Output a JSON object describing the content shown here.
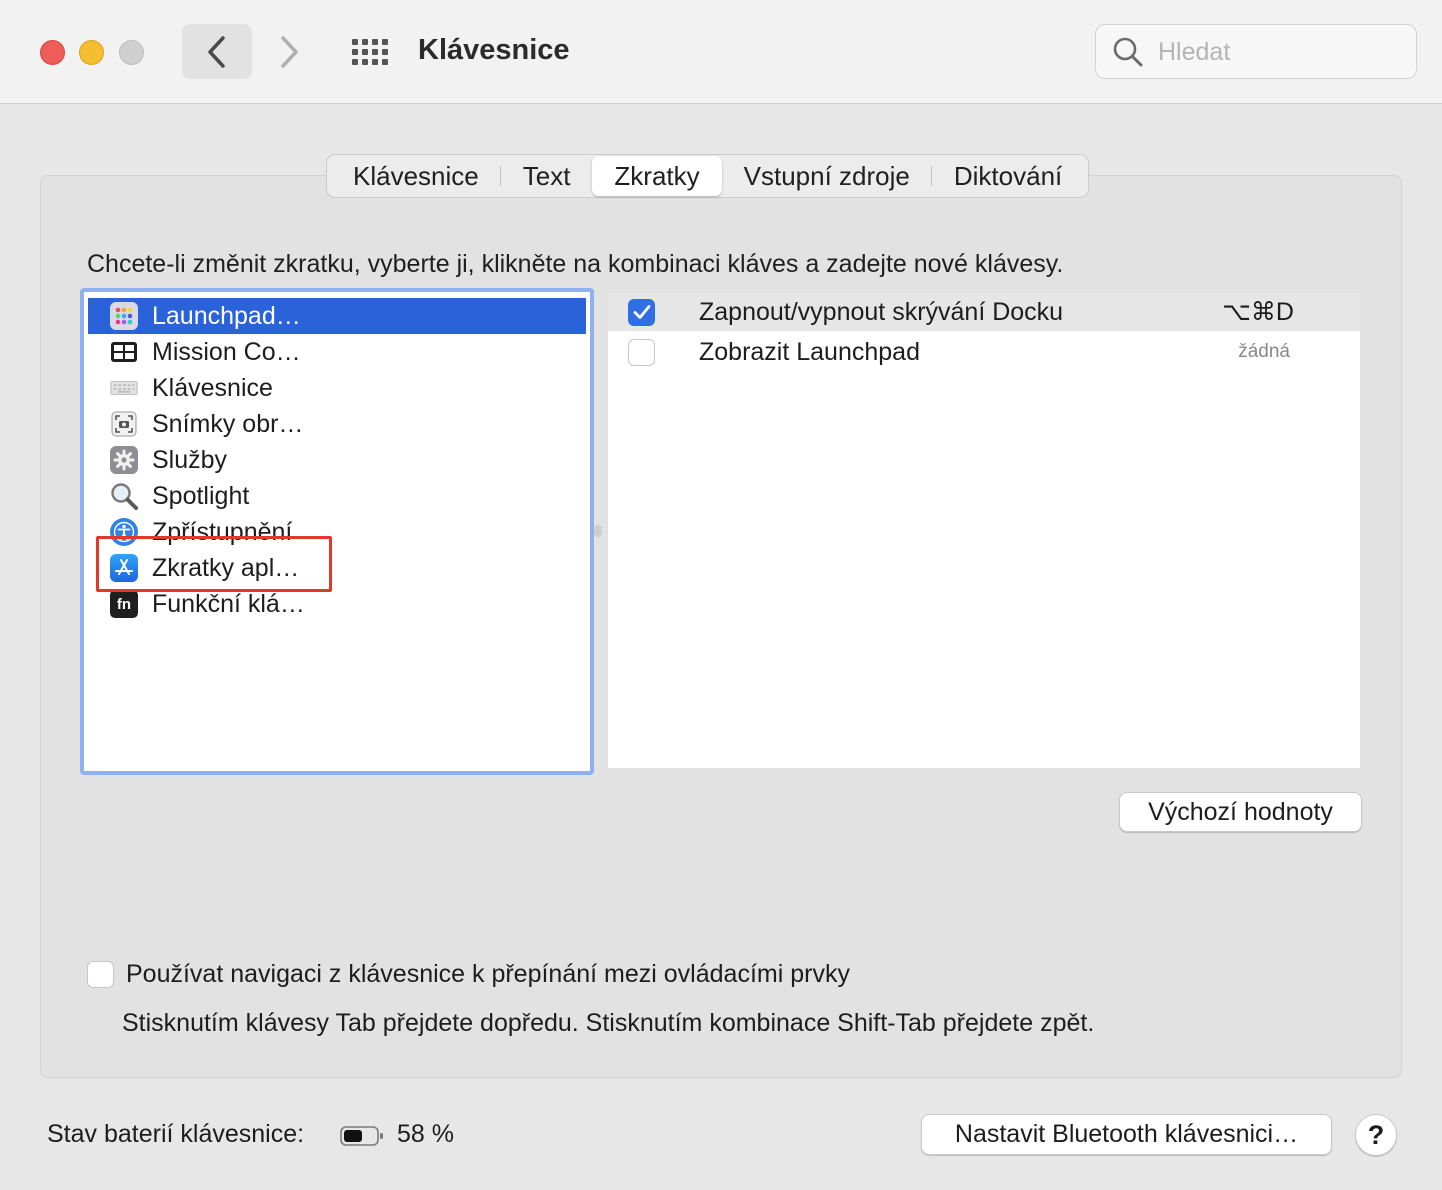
{
  "window": {
    "title": "Klávesnice",
    "search_placeholder": "Hledat"
  },
  "tabs": [
    {
      "label": "Klávesnice",
      "active": false
    },
    {
      "label": "Text",
      "active": false
    },
    {
      "label": "Zkratky",
      "active": true
    },
    {
      "label": "Vstupní zdroje",
      "active": false
    },
    {
      "label": "Diktování",
      "active": false
    }
  ],
  "instruction": "Chcete-li změnit zkratku, vyberte ji, klikněte na kombinaci kláves a zadejte nové klávesy.",
  "categories": [
    {
      "label": "Launchpad…",
      "icon": "launchpad-icon",
      "selected": true
    },
    {
      "label": "Mission Co…",
      "icon": "mission-control-icon",
      "selected": false
    },
    {
      "label": "Klávesnice",
      "icon": "keyboard-icon",
      "selected": false
    },
    {
      "label": "Snímky obr…",
      "icon": "screenshot-icon",
      "selected": false
    },
    {
      "label": "Služby",
      "icon": "gear-icon",
      "selected": false
    },
    {
      "label": "Spotlight",
      "icon": "magnifier-icon",
      "selected": false
    },
    {
      "label": "Zpřístupnění",
      "icon": "accessibility-icon",
      "selected": false
    },
    {
      "label": "Zkratky apl…",
      "icon": "app-store-icon",
      "selected": false
    },
    {
      "label": "Funkční klá…",
      "icon": "fn-key-icon",
      "selected": false
    }
  ],
  "shortcuts": [
    {
      "label": "Zapnout/vypnout skrývání Docku",
      "key": "⌥⌘D",
      "checked": true
    },
    {
      "label": "Zobrazit Launchpad",
      "key": "žádná",
      "checked": false
    }
  ],
  "buttons": {
    "defaults": "Výchozí hodnoty",
    "bluetooth": "Nastavit Bluetooth klávesnici…",
    "help": "?"
  },
  "keyboard_navigation": {
    "label": "Používat navigaci z klávesnice k přepínání mezi ovládacími prvky",
    "hint": "Stisknutím klávesy Tab přejdete dopředu. Stisknutím kombinace Shift-Tab přejdete zpět.",
    "checked": false
  },
  "battery": {
    "label": "Stav baterií klávesnice:",
    "value": "58 %",
    "level_percent": 58
  },
  "colors": {
    "accent": "#2a62d9",
    "checkbox": "#2f6fe4",
    "highlight_box": "#e0382b",
    "list_focus_ring": "#8fb1ef"
  }
}
